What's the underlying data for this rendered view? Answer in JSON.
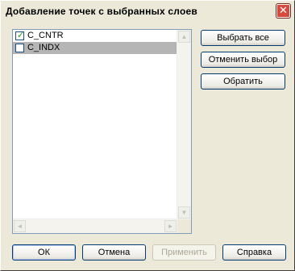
{
  "window": {
    "title": "Добавление точек с выбранных слоев",
    "close_glyph": "✕"
  },
  "layers": [
    {
      "name": "C_CNTR",
      "checked": true,
      "selected": false
    },
    {
      "name": "C_INDX",
      "checked": false,
      "selected": true
    }
  ],
  "side_buttons": {
    "select_all": "Выбрать все",
    "deselect": "Отменить выбор",
    "invert": "Обратить"
  },
  "bottom_buttons": {
    "ok": "ОК",
    "cancel": "Отмена",
    "apply": "Применить",
    "help": "Справка"
  },
  "glyphs": {
    "check": "✓",
    "arrow_up": "▲",
    "arrow_down": "▼",
    "arrow_left": "◄",
    "arrow_right": "►"
  }
}
